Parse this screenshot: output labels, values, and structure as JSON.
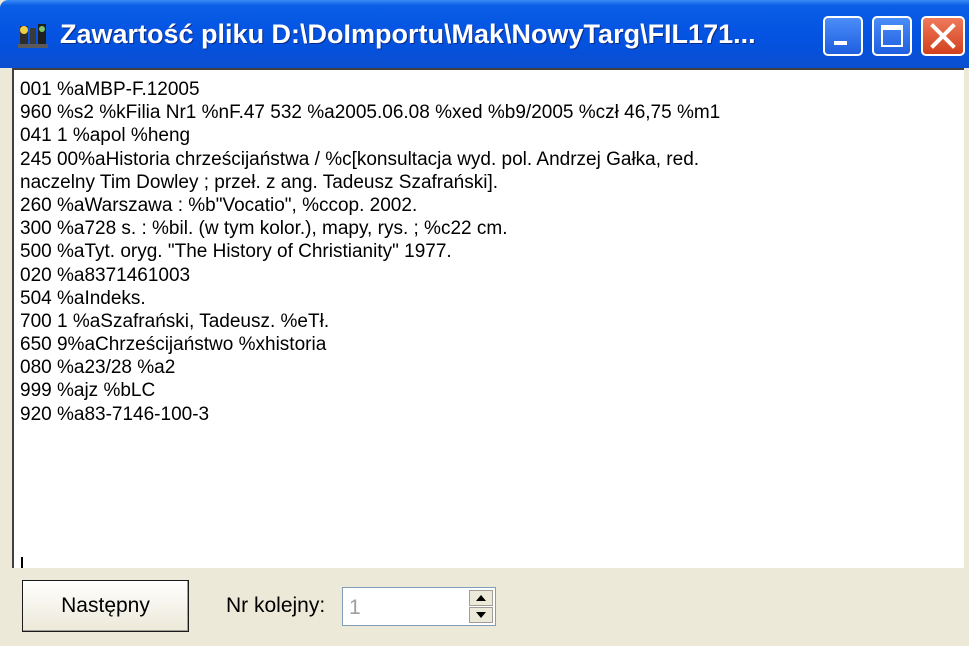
{
  "window": {
    "title": "Zawartość pliku D:\\DoImportu\\Mak\\NowyTarg\\FIL171..."
  },
  "editor": {
    "lines": [
      "001   %aMBP-F.12005",
      "960   %s2 %kFilia Nr1 %nF.47 532 %a2005.06.08 %xed %b9/2005 %czł 46,75 %m1",
      "041  1 %apol %heng",
      "245  00%aHistoria chrześcijaństwa / %c[konsultacja wyd. pol. Andrzej Gałka, red.",
      "naczelny Tim Dowley ; przeł. z ang. Tadeusz Szafrański].",
      "260   %aWarszawa : %b\"Vocatio\", %ccop. 2002.",
      "300   %a728 s. : %bil. (w tym kolor.), mapy, rys. ; %c22 cm.",
      "500   %aTyt. oryg. \"The History of Christianity\" 1977.",
      "020   %a8371461003",
      "504   %aIndeks.",
      "700  1 %aSzafrański, Tadeusz. %eTł.",
      "650   9%aChrześcijaństwo %xhistoria",
      "080   %a23/28 %a2",
      "999   %ajz %bLC",
      "920   %a83-7146-100-3"
    ]
  },
  "controls": {
    "next_button": "Następny",
    "nr_label": "Nr kolejny:",
    "nr_value": "1"
  },
  "icons": {
    "app": "app-icon",
    "minimize": "minimize-icon",
    "maximize": "maximize-icon",
    "close": "close-icon",
    "spin_up": "spin-up-icon",
    "spin_down": "spin-down-icon"
  },
  "colors": {
    "titlebar": "#0554e3",
    "close": "#d2401e",
    "face": "#ece9d8"
  }
}
